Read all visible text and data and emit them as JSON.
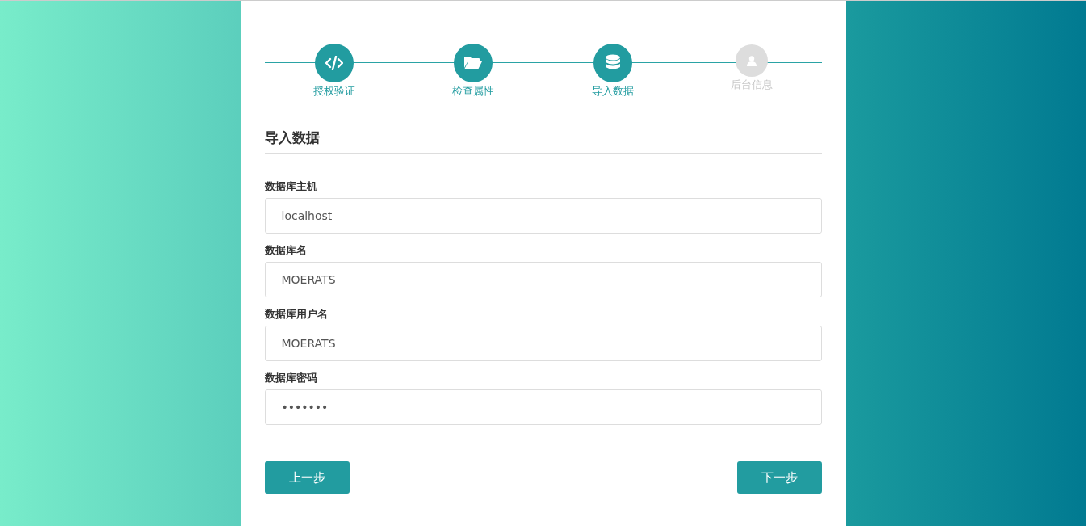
{
  "steps": [
    {
      "label": "授权验证",
      "done": true
    },
    {
      "label": "检查属性",
      "done": true
    },
    {
      "label": "导入数据",
      "done": true
    },
    {
      "label": "后台信息",
      "done": false
    }
  ],
  "section_title": "导入数据",
  "fields": [
    {
      "label": "数据库主机",
      "value": "localhost"
    },
    {
      "label": "数据库名",
      "value": "MOERATS"
    },
    {
      "label": "数据库用户名",
      "value": "MOERATS"
    },
    {
      "label": "数据库密码",
      "value": "•••••••"
    }
  ],
  "buttons": [
    "上一步",
    "下一步"
  ]
}
